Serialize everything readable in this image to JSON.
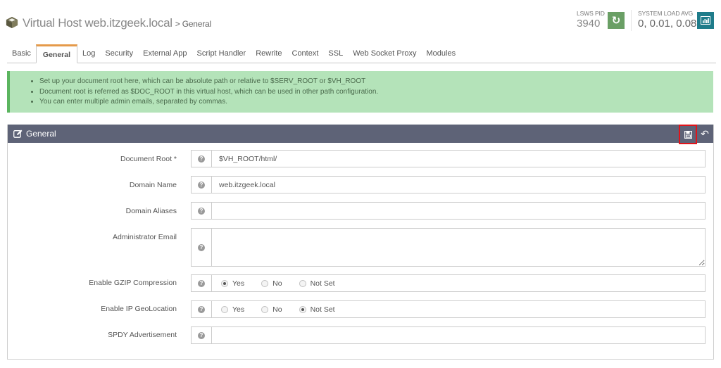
{
  "header": {
    "title": "Virtual Host web.itzgeek.local",
    "breadcrumb": "> General",
    "pid_label": "LSWS PID",
    "pid_value": "3940",
    "load_label": "SYSTEM LOAD AVG",
    "load_value": "0, 0.01, 0.08",
    "icons": {
      "title": "cube-icon",
      "refresh": "refresh-icon",
      "chart": "bar-chart-icon"
    }
  },
  "tabs": [
    {
      "label": "Basic",
      "active": false
    },
    {
      "label": "General",
      "active": true
    },
    {
      "label": "Log",
      "active": false
    },
    {
      "label": "Security",
      "active": false
    },
    {
      "label": "External App",
      "active": false
    },
    {
      "label": "Script Handler",
      "active": false
    },
    {
      "label": "Rewrite",
      "active": false
    },
    {
      "label": "Context",
      "active": false
    },
    {
      "label": "SSL",
      "active": false
    },
    {
      "label": "Web Socket Proxy",
      "active": false
    },
    {
      "label": "Modules",
      "active": false
    }
  ],
  "alert": {
    "items": [
      "Set up your document root here, which can be absolute path or relative to $SERV_ROOT or $VH_ROOT",
      "Document root is referred as $DOC_ROOT in this virtual host, which can be used in other path configuration.",
      "You can enter multiple admin emails, separated by commas."
    ]
  },
  "panel": {
    "title": "General",
    "icons": {
      "edit": "edit-icon",
      "save": "save-icon",
      "undo": "undo-icon"
    },
    "fields": {
      "doc_root": {
        "label": "Document Root *",
        "value": "$VH_ROOT/html/"
      },
      "domain_name": {
        "label": "Domain Name",
        "value": "web.itzgeek.local"
      },
      "domain_aliases": {
        "label": "Domain Aliases",
        "value": ""
      },
      "admin_email": {
        "label": "Administrator Email",
        "value": ""
      },
      "gzip": {
        "label": "Enable GZIP Compression",
        "options": [
          "Yes",
          "No",
          "Not Set"
        ],
        "selected": "Yes"
      },
      "geolocation": {
        "label": "Enable IP GeoLocation",
        "options": [
          "Yes",
          "No",
          "Not Set"
        ],
        "selected": "Not Set"
      },
      "spdy": {
        "label": "SPDY Advertisement",
        "value": ""
      }
    },
    "help_glyph": "?"
  },
  "colors": {
    "tab_accent": "#e59a4a",
    "alert_bg": "#b4e3b9",
    "alert_border": "#5bb55f",
    "panel_header": "#5e6377",
    "refresh_button": "#6a9f65",
    "chart_button": "#1f7c8a",
    "save_highlight": "#e1141a"
  }
}
